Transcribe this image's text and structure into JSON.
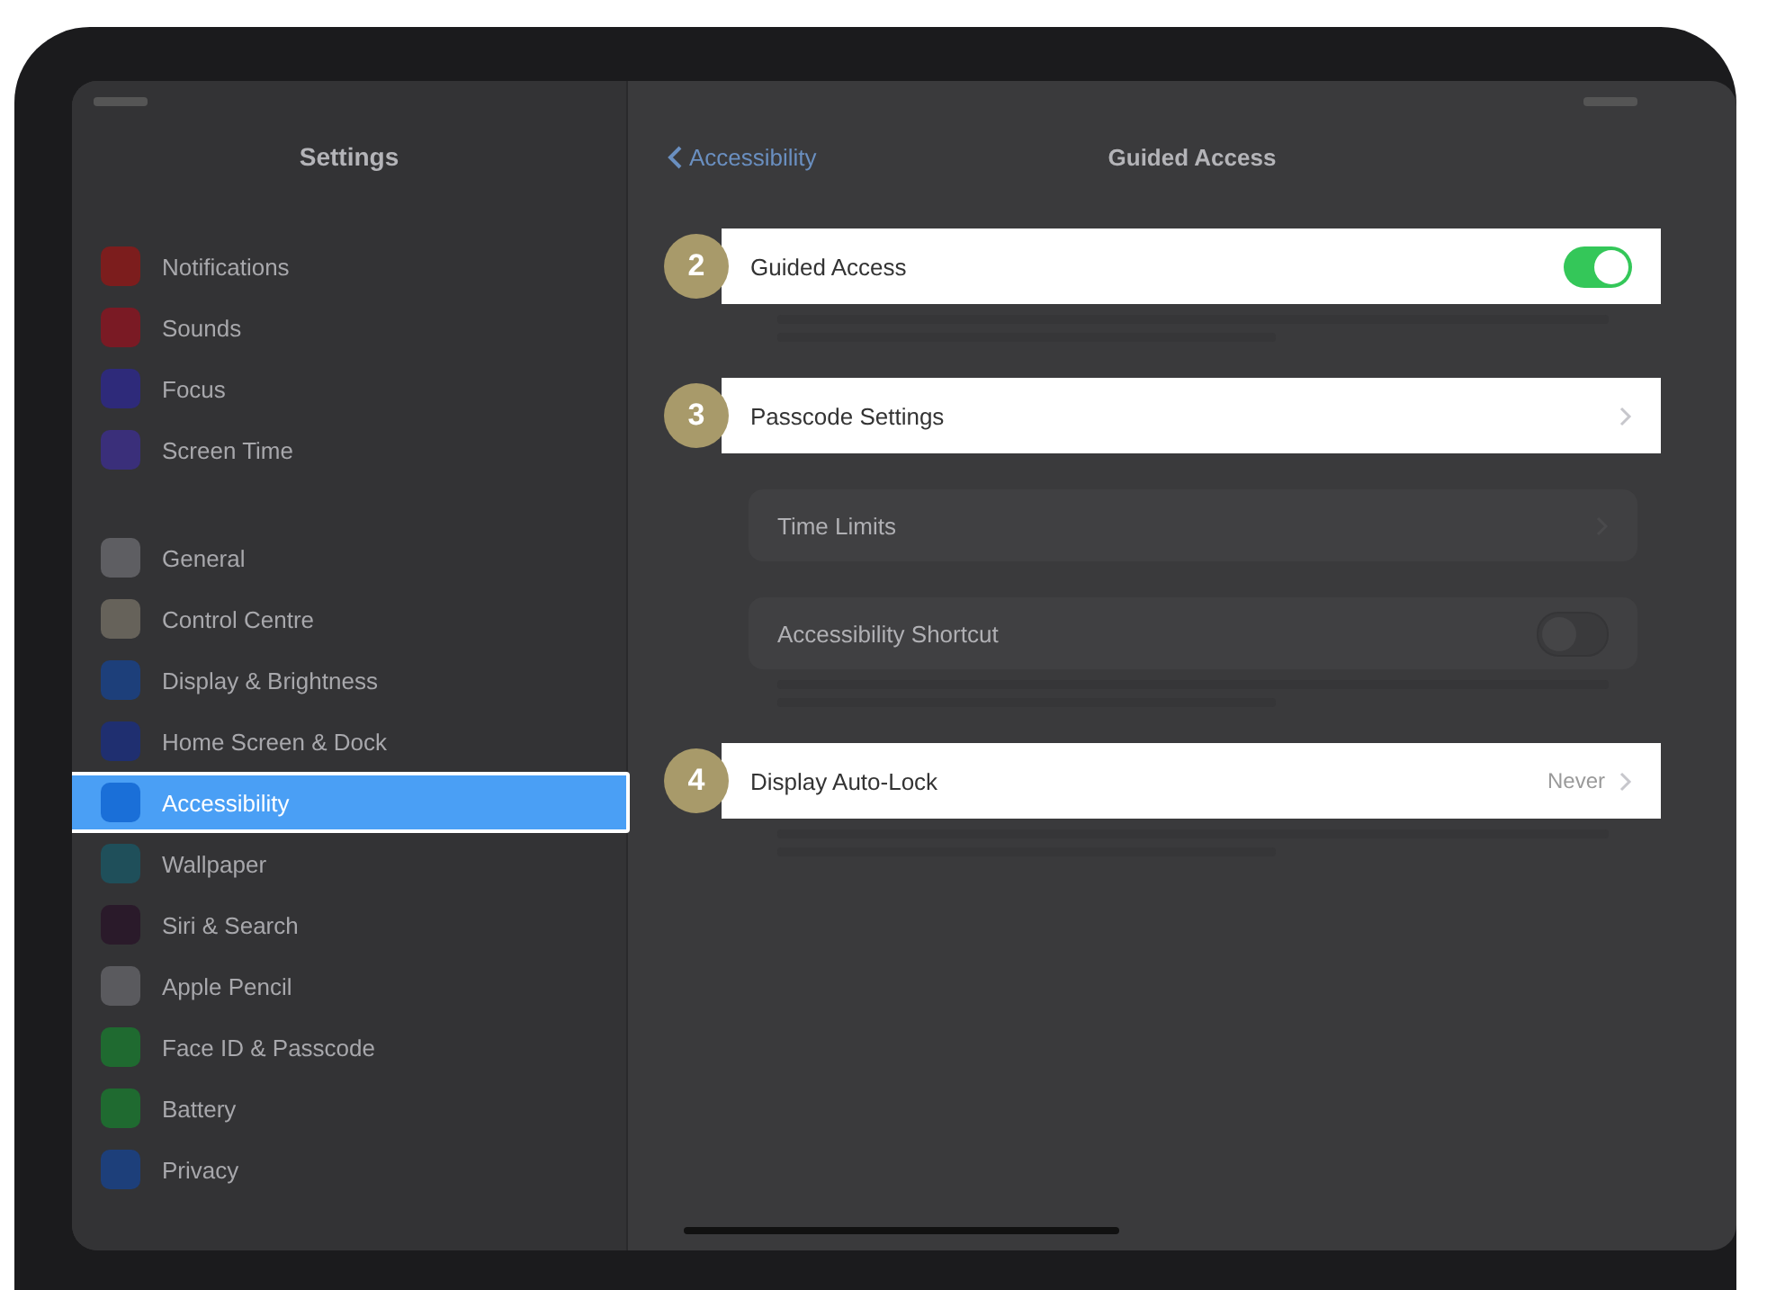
{
  "sidebar": {
    "title": "Settings",
    "groups": [
      {
        "items": [
          {
            "label": "Notifications",
            "color": "#7c1d1d",
            "selected": false
          },
          {
            "label": "Sounds",
            "color": "#7a1a24",
            "selected": false
          },
          {
            "label": "Focus",
            "color": "#2e2a7a",
            "selected": false
          },
          {
            "label": "Screen Time",
            "color": "#3a2f7a",
            "selected": false
          }
        ]
      },
      {
        "items": [
          {
            "label": "General",
            "color": "#5e5e62",
            "selected": false
          },
          {
            "label": "Control Centre",
            "color": "#66625a",
            "selected": false
          },
          {
            "label": "Display & Brightness",
            "color": "#1d3f7a",
            "selected": false
          },
          {
            "label": "Home Screen & Dock",
            "color": "#1f2f70",
            "selected": false
          },
          {
            "label": "Accessibility",
            "color": "#1a6fd8",
            "selected": true
          },
          {
            "label": "Wallpaper",
            "color": "#1f4f5a",
            "selected": false
          },
          {
            "label": "Siri & Search",
            "color": "#2a1a2a",
            "selected": false
          },
          {
            "label": "Apple Pencil",
            "color": "#5a5a5e",
            "selected": false
          },
          {
            "label": "Face ID & Passcode",
            "color": "#1f6a30",
            "selected": false
          },
          {
            "label": "Battery",
            "color": "#1f6a30",
            "selected": false
          },
          {
            "label": "Privacy",
            "color": "#1d3f7a",
            "selected": false
          }
        ]
      }
    ]
  },
  "detail": {
    "back_label": "Accessibility",
    "title": "Guided Access",
    "sections": [
      {
        "kind": "noted",
        "rows": [
          {
            "kind": "toggle",
            "label": "Guided Access",
            "on": true,
            "highlighted": true,
            "badge": "2"
          }
        ]
      },
      {
        "kind": "plain",
        "rows": [
          {
            "kind": "link",
            "label": "Passcode Settings",
            "highlighted": true,
            "badge": "3"
          }
        ]
      },
      {
        "kind": "plain",
        "rows": [
          {
            "kind": "link",
            "label": "Time Limits",
            "highlighted": false
          }
        ]
      },
      {
        "kind": "noted",
        "rows": [
          {
            "kind": "toggle",
            "label": "Accessibility Shortcut",
            "on": false,
            "highlighted": false
          }
        ]
      },
      {
        "kind": "noted",
        "rows": [
          {
            "kind": "link",
            "label": "Display Auto-Lock",
            "value": "Never",
            "highlighted": true,
            "badge": "4"
          }
        ]
      }
    ]
  }
}
